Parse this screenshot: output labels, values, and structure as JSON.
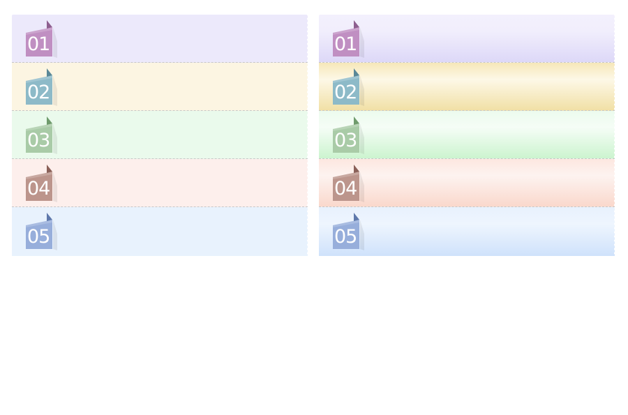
{
  "left_panel": {
    "rows": [
      {
        "number": "01",
        "bg": "#ece9fb",
        "tag": "#c08fc2",
        "fold": "#8e5f8f"
      },
      {
        "number": "02",
        "bg": "#fcf5e2",
        "tag": "#8dbac8",
        "fold": "#5a8897"
      },
      {
        "number": "03",
        "bg": "#eafaec",
        "tag": "#a9cba7",
        "fold": "#6f9b6c"
      },
      {
        "number": "04",
        "bg": "#fdefec",
        "tag": "#bc958c",
        "fold": "#8a6058"
      },
      {
        "number": "05",
        "bg": "#e8f2fd",
        "tag": "#97aedb",
        "fold": "#5e78ab"
      }
    ]
  },
  "right_panel": {
    "rows": [
      {
        "number": "01",
        "bg_top": "#f3f0fd",
        "bg_mid": "#f1eefc",
        "bg_bottom": "#ddd8f8",
        "tag": "#c08fc2",
        "fold": "#8e5f8f"
      },
      {
        "number": "02",
        "bg_top": "#f6e7b8",
        "bg_mid": "#fdf8e7",
        "bg_bottom": "#f1e0a6",
        "tag": "#8dbac8",
        "fold": "#5a8897"
      },
      {
        "number": "03",
        "bg_top": "#ecfbee",
        "bg_mid": "#f5fdf6",
        "bg_bottom": "#ccf4cf",
        "tag": "#a9cba7",
        "fold": "#6f9b6c"
      },
      {
        "number": "04",
        "bg_top": "#fde7e0",
        "bg_mid": "#fdf3f0",
        "bg_bottom": "#fad8cc",
        "tag": "#bc958c",
        "fold": "#8a6058"
      },
      {
        "number": "05",
        "bg_top": "#e8f1fd",
        "bg_mid": "#eef5fe",
        "bg_bottom": "#cfe2fb",
        "tag": "#97aedb",
        "fold": "#5e78ab"
      }
    ]
  }
}
